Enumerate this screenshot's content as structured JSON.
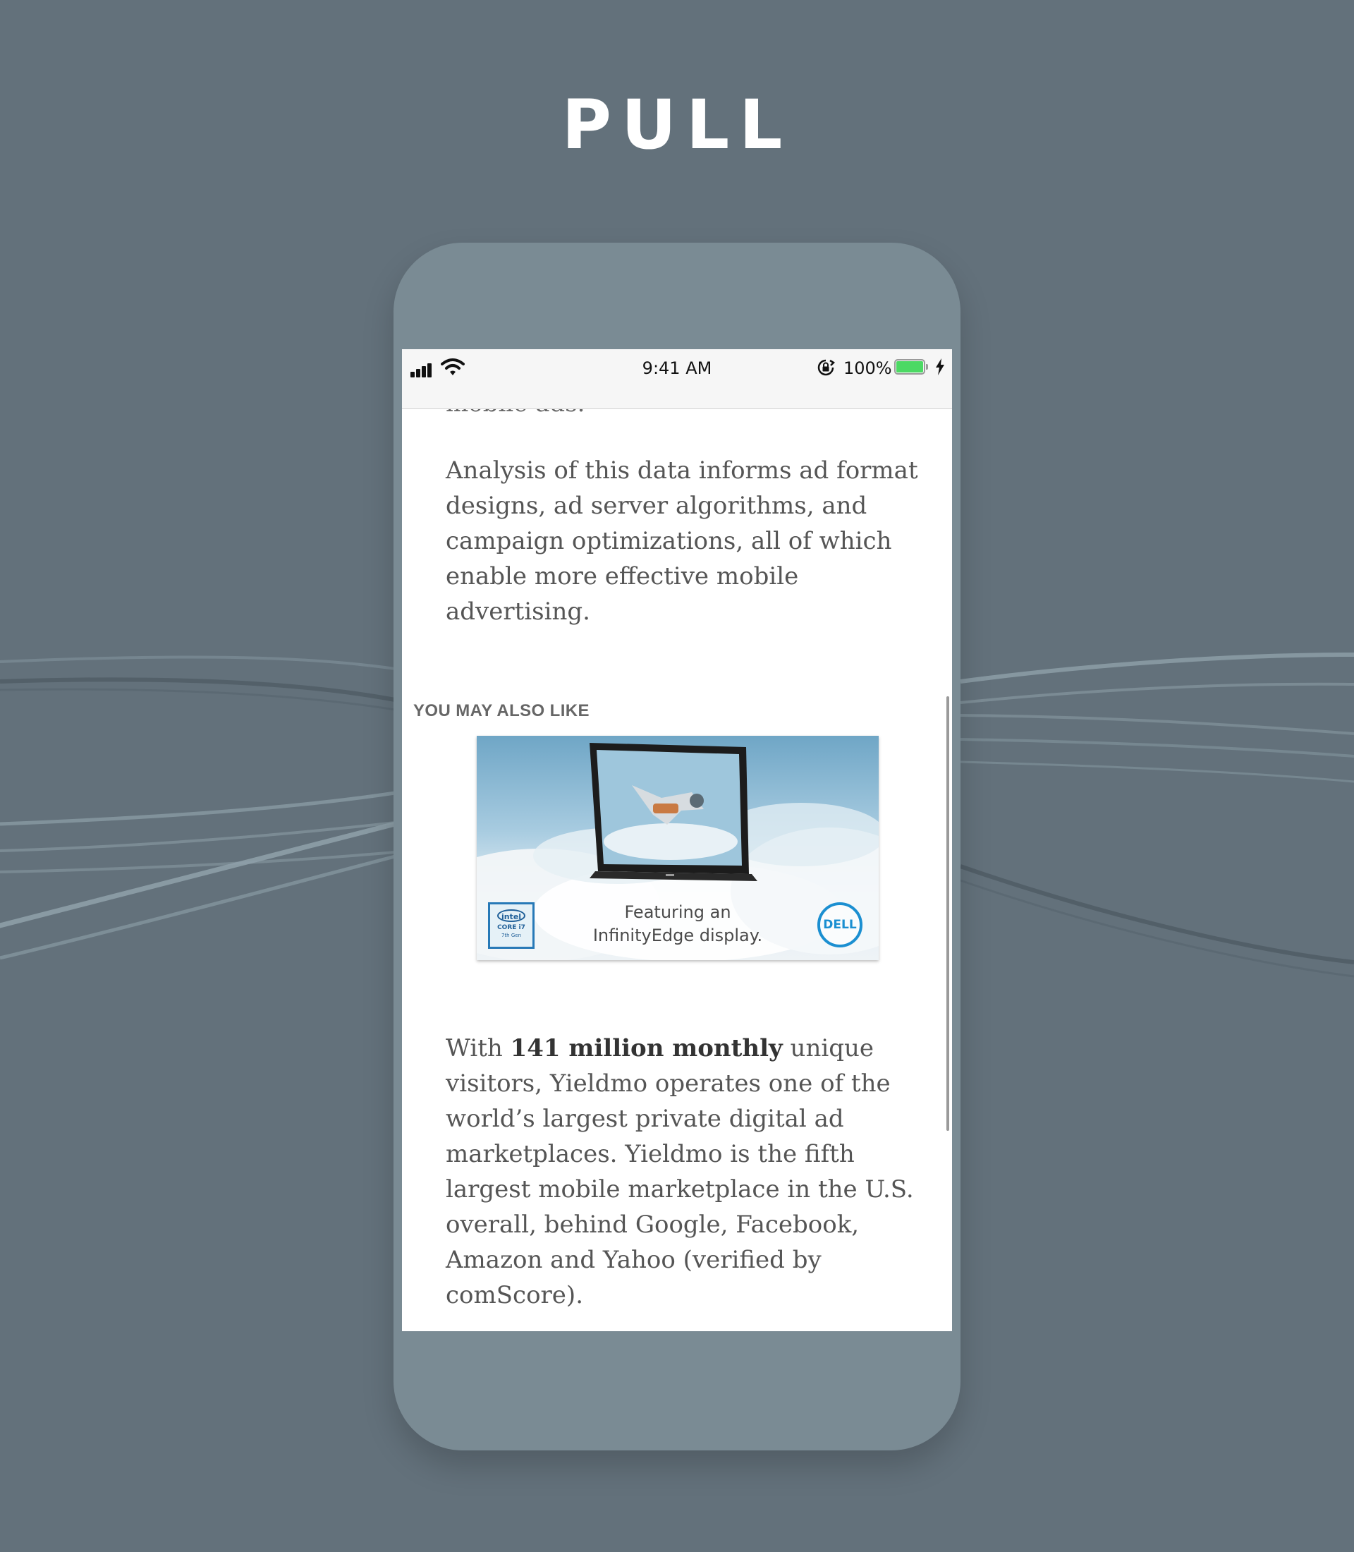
{
  "page": {
    "title": "PULL"
  },
  "phone": {
    "status_bar": {
      "time": "9:41 AM",
      "battery_percent": "100%",
      "battery_level": 1.0,
      "icons": [
        "cellular-signal-icon",
        "wifi-icon",
        "orientation-lock-icon",
        "battery-icon",
        "charging-bolt-icon"
      ]
    },
    "article": {
      "cut_off_text": "mobile ads.",
      "paragraph_1": "Analysis of this data informs ad format designs, ad server algorithms, and campaign optimizations, all of which enable more effective mobile advertising.",
      "paragraph_2_prefix": "With ",
      "paragraph_2_bold": "141 million monthly",
      "paragraph_2_rest": " unique visitors, Yieldmo operates one of the world’s largest private digital ad marketplaces. Yieldmo is the fifth largest mobile marketplace in the U.S. overall, behind Google, Facebook, Amazon and Yahoo (verified by comScore)."
    },
    "recommendations": {
      "label": "YOU MAY ALSO LIKE",
      "ad": {
        "caption_line_1": "Featuring an",
        "caption_line_2": "InfinityEdge display.",
        "intel_logo_text": "intel",
        "intel_core_text": "CORE i7",
        "intel_gen_text": "7th Gen",
        "brand_logo_text": "DELL"
      }
    }
  },
  "colors": {
    "background": "#63717b",
    "phone_body": "#7a8b94",
    "battery_fill": "#4cd964",
    "dell_blue": "#1b8fd1",
    "intel_blue": "#2779b7"
  }
}
